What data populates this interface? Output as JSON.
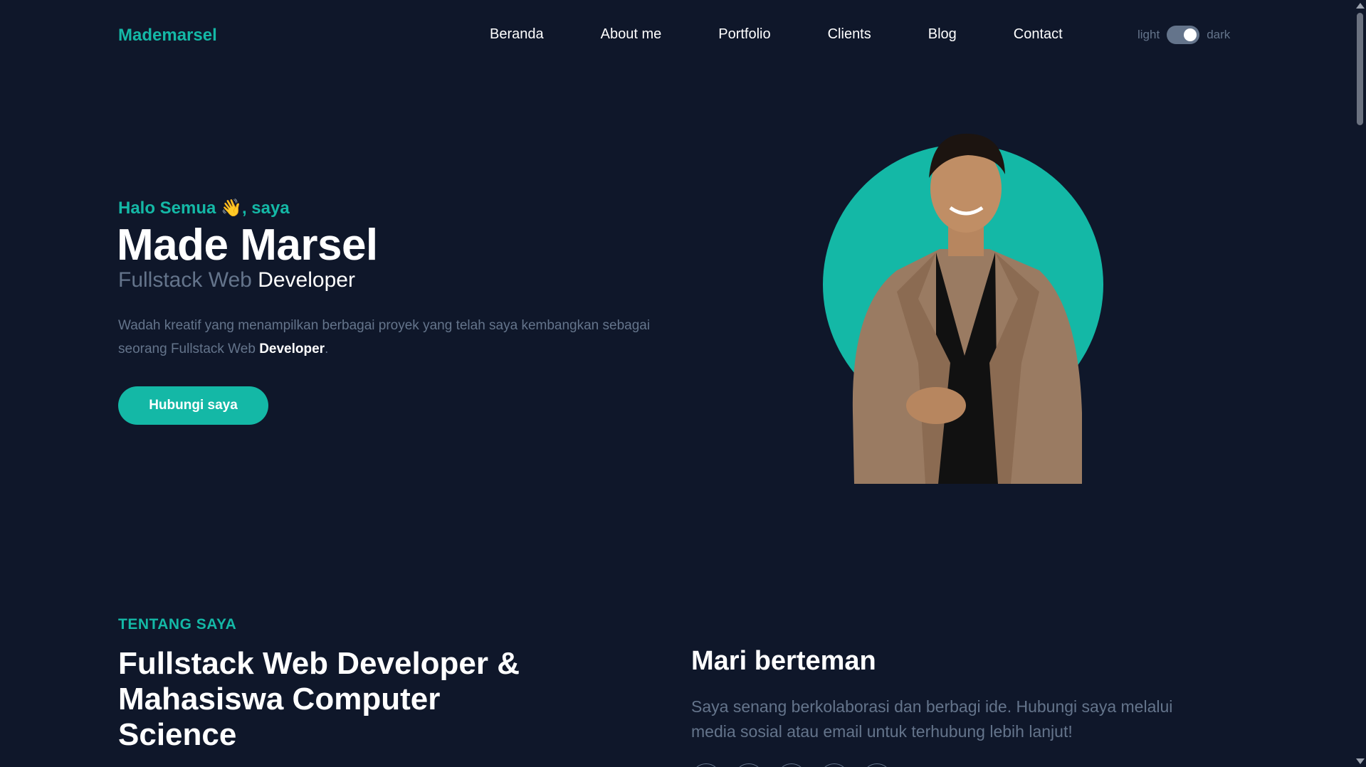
{
  "header": {
    "logo": "Mademarsel",
    "nav": [
      "Beranda",
      "About me",
      "Portfolio",
      "Clients",
      "Blog",
      "Contact"
    ],
    "theme": {
      "light_label": "light",
      "dark_label": "dark",
      "mode": "dark"
    }
  },
  "hero": {
    "greeting_prefix": "Halo Semua ",
    "greeting_emoji": "👋",
    "greeting_suffix": ", saya",
    "name": "Made Marsel",
    "role_muted": "Fullstack Web",
    "role_strong": "Developer",
    "description_prefix": "Wadah kreatif yang menampilkan berbagai proyek yang telah saya kembangkan sebagai seorang Fullstack Web ",
    "description_bold": "Developer",
    "description_suffix": ".",
    "cta_label": "Hubungi saya"
  },
  "about": {
    "label": "TENTANG SAYA",
    "title": "Fullstack Web Developer & Mahasiswa Computer Science",
    "friend_title": "Mari berteman",
    "friend_desc": "Saya senang berkolaborasi dan berbagi ide. Hubungi saya melalui media sosial atau email untuk terhubung lebih lanjut!"
  },
  "colors": {
    "background": "#0f172a",
    "accent": "#14b8a6",
    "muted": "#64748b",
    "text": "#ffffff"
  },
  "icons": [
    "waving-hand-icon",
    "scroll-up-arrow-icon",
    "scroll-down-arrow-icon"
  ]
}
